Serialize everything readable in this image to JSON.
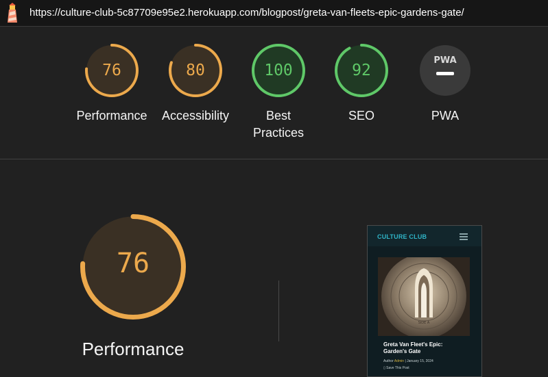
{
  "browser": {
    "url": "https://culture-club-5c87709e95e2.herokuapp.com/blogpost/greta-van-fleets-epic-gardens-gate/",
    "logo_icon": "lighthouse-icon"
  },
  "colors": {
    "orange": "#eca94c",
    "green": "#5fc868",
    "gray": "#3a3a3a",
    "orange_track": "#3a3024",
    "green_track": "#203a24"
  },
  "scores": [
    {
      "label": "Performance",
      "value": "76",
      "score": 76,
      "status": "average"
    },
    {
      "label": "Accessibility",
      "value": "80",
      "score": 80,
      "status": "average"
    },
    {
      "label": "Best Practices",
      "value": "100",
      "score": 100,
      "status": "pass"
    },
    {
      "label": "SEO",
      "value": "92",
      "score": 92,
      "status": "pass"
    },
    {
      "label": "PWA",
      "value": "",
      "score": null,
      "status": "na",
      "badge": "PWA"
    }
  ],
  "detail": {
    "score": 76,
    "value": "76",
    "label": "Performance"
  },
  "thumbnail": {
    "brand": "CULTURE CLUB",
    "title": "Greta Van Fleet's Epic: Garden's Gate",
    "author_prefix": "Author",
    "author": "Admin",
    "date": "| January 15, 2024",
    "save": "Save This Post",
    "record_label": "SIDE A"
  }
}
